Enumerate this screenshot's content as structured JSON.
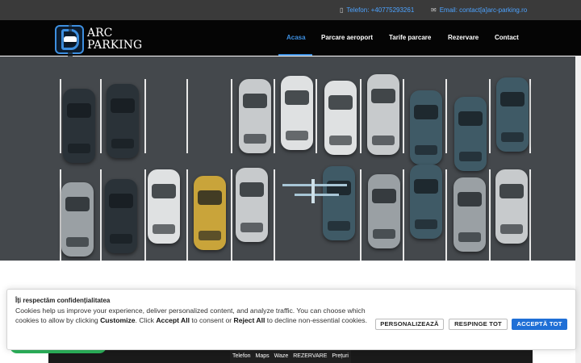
{
  "topbar": {
    "phone_icon": "phone-icon",
    "phone": "Telefon: +40775293261",
    "email_icon": "envelope-icon",
    "email": "Email: contact[a]arc-parking.ro"
  },
  "logo": {
    "line1": "ARC",
    "line2": "PARKING",
    "badge_text": "PARKING"
  },
  "nav": [
    {
      "label": "Acasa",
      "active": true
    },
    {
      "label": "Parcare aeroport"
    },
    {
      "label": "Tarife parcare"
    },
    {
      "label": "Rezervare"
    },
    {
      "label": "Contact"
    }
  ],
  "cookie": {
    "title": "Îți respectăm confidențialitatea",
    "text_part1": "Cookies help us improve your experience, deliver personalized content, and analyze traffic. You can choose which cookies to allow by clicking ",
    "customize": "Customize",
    "text_part2": ". Click ",
    "accept_all": "Accept All",
    "text_part3": " to consent or ",
    "reject_all": "Reject All",
    "text_part4": " to decline non-essential cookies.",
    "btn_customize": "PERSONALIZEAZĂ",
    "btn_reject": "RESPINGE TOT",
    "btn_accept": "ACCEPTĂ TOT"
  },
  "bottom_bar": [
    "Telefon",
    "Maps",
    "Waze",
    "REZERVARE",
    "Prețuri"
  ],
  "colors": {
    "accent": "#3d8fe0",
    "primary_button": "#1f6fd6",
    "whatsapp_green": "#2bb15a"
  }
}
